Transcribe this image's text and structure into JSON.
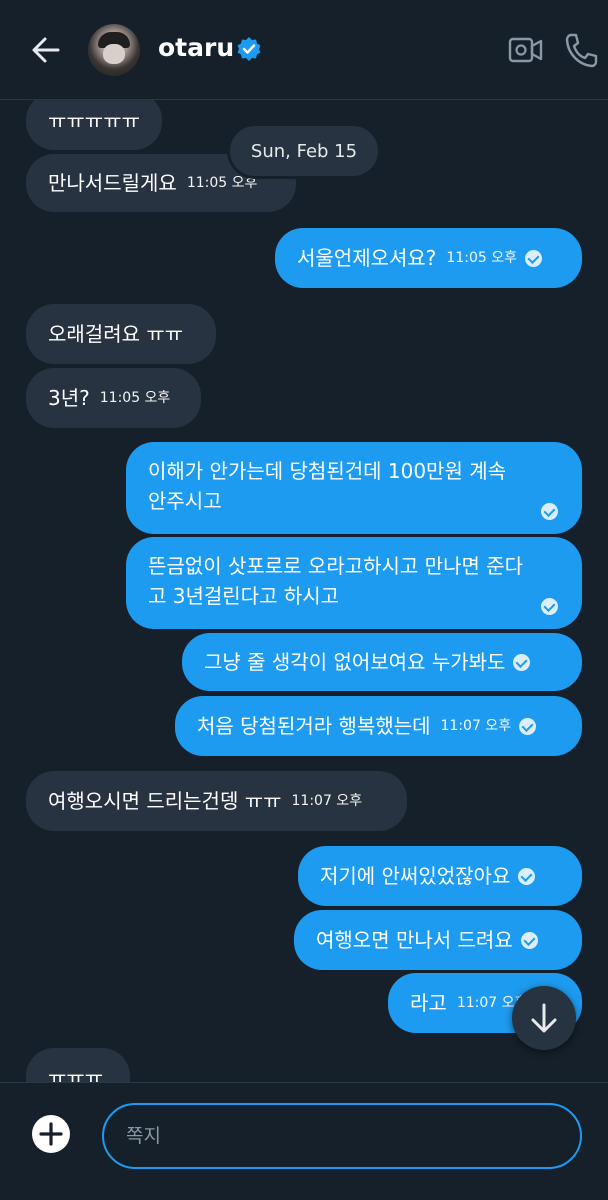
{
  "header": {
    "name": "otaru",
    "back_icon": "arrow-left-icon",
    "verified_icon": "verified-badge-icon",
    "video_icon": "video-call-icon",
    "phone_icon": "phone-icon",
    "colors": {
      "background": "#15202b",
      "accent": "#1d9bf0"
    }
  },
  "thread": {
    "date_separator": "Sun, Feb 15",
    "messages": [
      {
        "dir": "in",
        "text": "ㅠㅠㅠㅠㅠ"
      },
      {
        "dir": "in",
        "text": "만나서드릴게요",
        "time": "11:05 오후"
      },
      {
        "dir": "out",
        "text": "서울언제오셔요?",
        "time": "11:05 오후"
      },
      {
        "dir": "in",
        "text": "오래걸려요 ㅠㅠ"
      },
      {
        "dir": "in",
        "text": "3년?",
        "time": "11:05 오후"
      },
      {
        "dir": "out",
        "text": "이해가 안가는데 당첨된건데 100만원 계속 안주시고"
      },
      {
        "dir": "out",
        "text": "뜬금없이 삿포로로 오라고하시고 만나면 준다고 3년걸린다고 하시고"
      },
      {
        "dir": "out",
        "text": "그냥 줄 생각이 없어보여요 누가봐도"
      },
      {
        "dir": "out",
        "text": "처음 당첨된거라 행복했는데",
        "time": "11:07 오후"
      },
      {
        "dir": "in",
        "text": "여행오시면 드리는건뎅 ㅠㅠ",
        "time": "11:07 오후"
      },
      {
        "dir": "out",
        "text": "저기에 안써있었잖아요"
      },
      {
        "dir": "out",
        "text": "여행오면 만나서 드려요"
      },
      {
        "dir": "out",
        "text": "라고",
        "time": "11:07 오후"
      },
      {
        "dir": "in",
        "text": "ㅠㅠㅠ"
      }
    ]
  },
  "scroll_down_icon": "arrow-down-icon",
  "composer": {
    "add_icon": "plus-circle-icon",
    "placeholder": "쪽지"
  }
}
